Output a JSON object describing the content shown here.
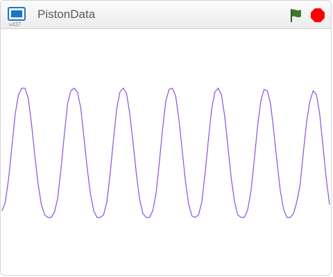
{
  "app": {
    "title": "PistonData",
    "version": "v437"
  },
  "controls": {
    "green_flag_icon": "green-flag-icon",
    "stop_icon": "stop-sign-icon"
  },
  "colors": {
    "plot_line": "#8a4fd8",
    "flag": "#3d7a2b",
    "stop": "#ff0000",
    "logo": "#1c74c4"
  },
  "chart_data": {
    "type": "line",
    "series": [
      {
        "color": "#8a4fd8",
        "x": [
          0,
          0.05,
          0.1,
          0.15,
          0.2,
          0.25,
          0.3,
          0.35,
          0.4,
          0.45,
          0.5,
          0.55,
          0.6,
          0.65,
          0.7,
          0.75,
          0.8,
          0.85,
          0.9,
          0.95,
          1.0,
          1.05,
          1.1,
          1.15,
          1.2,
          1.25,
          1.3,
          1.35,
          1.4,
          1.45,
          1.5,
          1.55,
          1.6,
          1.65,
          1.7,
          1.75,
          1.8,
          1.85,
          1.9,
          1.95,
          2.0,
          2.05,
          2.1,
          2.15,
          2.2,
          2.25,
          2.3,
          2.35,
          2.4,
          2.45,
          2.5,
          2.55,
          2.6,
          2.65,
          2.7,
          2.75,
          2.8,
          2.85,
          2.9,
          2.95,
          3.0,
          3.05,
          3.1,
          3.15,
          3.2,
          3.25,
          3.3,
          3.35,
          3.4,
          3.45,
          3.5,
          3.55,
          3.6,
          3.65,
          3.7,
          3.75,
          3.8,
          3.85,
          3.9,
          3.95,
          4.0,
          4.05,
          4.1,
          4.15,
          4.2,
          4.25,
          4.3,
          4.35,
          4.4,
          4.45,
          4.5,
          4.55,
          4.6,
          4.65,
          4.7,
          4.75,
          4.8,
          4.85,
          4.9,
          4.95,
          5.0
        ],
        "y": [
          0.05,
          0.12,
          0.3,
          0.55,
          0.8,
          0.95,
          1.0,
          1.0,
          0.92,
          0.72,
          0.48,
          0.26,
          0.1,
          0.02,
          0.0,
          0.0,
          0.04,
          0.15,
          0.38,
          0.64,
          0.88,
          0.98,
          1.0,
          0.97,
          0.85,
          0.62,
          0.38,
          0.18,
          0.05,
          0.0,
          0.0,
          0.02,
          0.12,
          0.34,
          0.6,
          0.84,
          0.97,
          1.0,
          0.96,
          0.8,
          0.58,
          0.34,
          0.14,
          0.03,
          0.0,
          0.0,
          0.05,
          0.18,
          0.42,
          0.68,
          0.9,
          0.99,
          1.0,
          0.94,
          0.76,
          0.52,
          0.28,
          0.1,
          0.01,
          0.0,
          0.02,
          0.12,
          0.34,
          0.6,
          0.84,
          0.97,
          1.0,
          0.95,
          0.78,
          0.54,
          0.3,
          0.12,
          0.02,
          0.0,
          0.0,
          0.06,
          0.2,
          0.44,
          0.7,
          0.9,
          0.99,
          0.98,
          0.88,
          0.66,
          0.42,
          0.2,
          0.06,
          0.0,
          0.0,
          0.03,
          0.12,
          0.25,
          0.5,
          0.74,
          0.9,
          0.98,
          0.95,
          0.8,
          0.55,
          0.3,
          0.1
        ]
      }
    ],
    "xlim": [
      0,
      5.0
    ],
    "ylim": [
      -0.15,
      1.35
    ],
    "grid": false,
    "legend": "none"
  }
}
